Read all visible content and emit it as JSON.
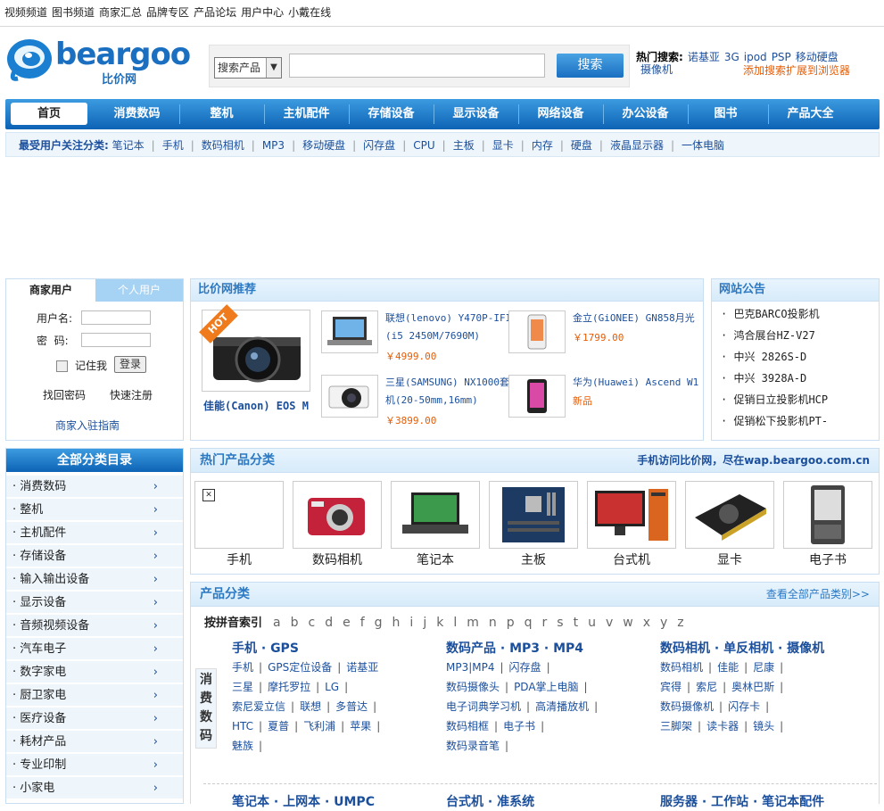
{
  "toplinks": [
    "视频频道",
    "图书频道",
    "商家汇总",
    "品牌专区",
    "产品论坛",
    "用户中心",
    "小戴在线"
  ],
  "logo": {
    "text": "beargoo",
    "subtitle": "比价网"
  },
  "search": {
    "select_value": "搜索产品",
    "placeholder": "",
    "button": "搜索"
  },
  "hot_search": {
    "label": "热门搜索:",
    "keywords": [
      "诺基亚",
      "3G",
      "ipod",
      "PSP",
      "移动硬盘",
      "摄像机"
    ],
    "extension_link": "添加搜索扩展到浏览器"
  },
  "nav": [
    "首页",
    "消费数码",
    "整机",
    "主机配件",
    "存储设备",
    "显示设备",
    "网络设备",
    "办公设备",
    "图书",
    "产品大全"
  ],
  "subnav": {
    "label": "最受用户关注分类:",
    "items": [
      "笔记本",
      "手机",
      "数码相机",
      "MP3",
      "移动硬盘",
      "闪存盘",
      "CPU",
      "主板",
      "显卡",
      "内存",
      "硬盘",
      "液晶显示器",
      "一体电脑"
    ]
  },
  "login": {
    "tab_merchant": "商家用户",
    "tab_personal": "个人用户",
    "username_label": "用户名:",
    "password_label": "密  码:",
    "remember": "记住我",
    "login_button": "登录",
    "forgot": "找回密码",
    "register": "快速注册",
    "merchant_guide": "商家入驻指南"
  },
  "recommend": {
    "title": "比价网推荐",
    "featured": {
      "name": "佳能(Canon) EOS M",
      "badge": "HOT"
    },
    "items": [
      {
        "name_line1": "联想(lenovo) Y470P-IFI",
        "name_line2": "(i5 2450M/7690M)",
        "price": "￥4999.00"
      },
      {
        "name_line1": "金立(GiONEE) GN858月光",
        "name_line2": "",
        "price": "￥1799.00"
      },
      {
        "name_line1": "三星(SAMSUNG) NX1000套",
        "name_line2": "机(20-50mm,16mm)",
        "price": "￥3899.00"
      },
      {
        "name_line1": "华为(Huawei) Ascend W1",
        "name_line2": "",
        "price": "新品"
      }
    ]
  },
  "notice": {
    "title": "网站公告",
    "items": [
      "巴克BARCO投影机",
      "鸿合展台HZ-V27",
      "中兴 2826S-D",
      "中兴 3928A-D",
      "促销日立投影机HCP",
      "促销松下投影机PT-"
    ]
  },
  "categories": {
    "title": "全部分类目录",
    "items": [
      "消费数码",
      "整机",
      "主机配件",
      "存储设备",
      "输入输出设备",
      "显示设备",
      "音频视频设备",
      "汽车电子",
      "数字家电",
      "厨卫家电",
      "医疗设备",
      "耗材产品",
      "专业印制",
      "小家电"
    ]
  },
  "hot_categories": {
    "title": "热门产品分类",
    "mobile_note": "手机访问比价网，尽在wap.beargoo.com.cn",
    "items": [
      "手机",
      "数码相机",
      "笔记本",
      "主板",
      "台式机",
      "显卡",
      "电子书"
    ]
  },
  "product_categories": {
    "title": "产品分类",
    "view_all": "查看全部产品类别>>",
    "pinyin_label": "按拼音索引",
    "letters": [
      "a",
      "b",
      "c",
      "d",
      "e",
      "f",
      "g",
      "h",
      "i",
      "j",
      "k",
      "l",
      "m",
      "n",
      "p",
      "q",
      "r",
      "s",
      "t",
      "u",
      "v",
      "w",
      "x",
      "y",
      "z"
    ],
    "side_label": "消费数码",
    "groups": [
      {
        "title": "手机 · GPS",
        "rows": [
          [
            "手机",
            "GPS定位设备",
            "诺基亚"
          ],
          [
            "三星",
            "摩托罗拉",
            "LG"
          ],
          [
            "索尼爱立信",
            "联想",
            "多普达"
          ],
          [
            "HTC",
            "夏普",
            "飞利浦",
            "苹果"
          ],
          [
            "魅族"
          ]
        ]
      },
      {
        "title": "数码产品 · MP3 · MP4",
        "rows": [
          [
            "MP3|MP4",
            "闪存盘"
          ],
          [
            "数码摄像头",
            "PDA掌上电脑"
          ],
          [
            "电子词典学习机",
            "高清播放机"
          ],
          [
            "数码相框",
            "电子书"
          ],
          [
            "数码录音笔"
          ]
        ]
      },
      {
        "title": "数码相机 · 单反相机 · 摄像机",
        "rows": [
          [
            "数码相机",
            "佳能",
            "尼康"
          ],
          [
            "宾得",
            "索尼",
            "奥林巴斯"
          ],
          [
            "数码摄像机",
            "闪存卡"
          ],
          [
            "三脚架",
            "读卡器",
            "镜头"
          ]
        ]
      }
    ],
    "next_groups": [
      "笔记本 · 上网本 · UMPC",
      "台式机 · 准系统",
      "服务器 · 工作站 · 笔记本配件"
    ]
  }
}
